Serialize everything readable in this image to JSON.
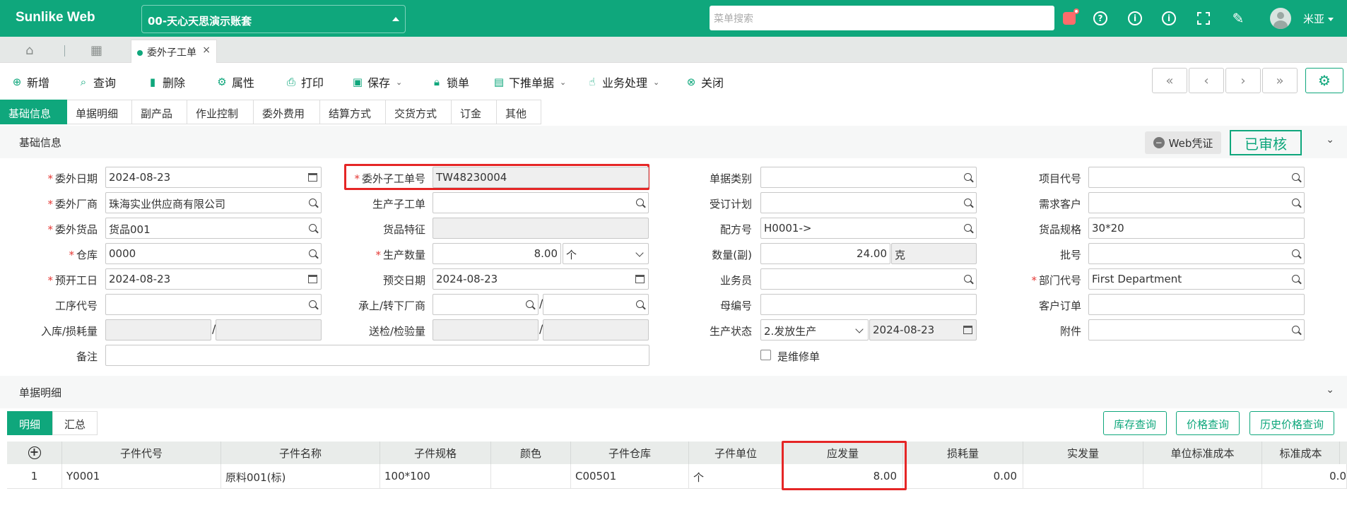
{
  "app": {
    "logo": "Sunlike Web",
    "account": "00-天心天思演示账套",
    "search_placeholder": "菜单搜索",
    "user": "米亚"
  },
  "tabbar": {
    "doc_tab": "委外子工单"
  },
  "toolbar": {
    "add": "新增",
    "query": "查询",
    "delete": "删除",
    "props": "属性",
    "print": "打印",
    "save": "保存",
    "lock": "锁单",
    "push": "下推单据",
    "biz": "业务处理",
    "close": "关闭"
  },
  "nav_buttons": [
    "«",
    "‹",
    "›",
    "»"
  ],
  "subtabs": [
    "基础信息",
    "单据明细",
    "副产品",
    "作业控制",
    "委外费用",
    "结算方式",
    "交货方式",
    "订金",
    "其他"
  ],
  "basic": {
    "title": "基础信息",
    "web_voucher": "Web凭证",
    "stamp": "已审核"
  },
  "form": {
    "col1": [
      {
        "label": "委外日期",
        "req": true,
        "value": "2024-08-23"
      },
      {
        "label": "委外厂商",
        "req": true,
        "value": "珠海实业供应商有限公司"
      },
      {
        "label": "委外货品",
        "req": true,
        "value": "货品001"
      },
      {
        "label": "仓库",
        "req": true,
        "value": "0000"
      },
      {
        "label": "预开工日",
        "req": true,
        "value": "2024-08-23"
      },
      {
        "label": "工序代号",
        "req": false,
        "value": ""
      },
      {
        "label": "入库/损耗量",
        "req": false,
        "value": ""
      },
      {
        "label": "备注",
        "req": false,
        "value": ""
      }
    ],
    "col2": [
      {
        "label": "委外子工单号",
        "req": true,
        "value": "TW48230004"
      },
      {
        "label": "生产子工单",
        "req": false,
        "value": ""
      },
      {
        "label": "货品特征",
        "req": false,
        "value": ""
      },
      {
        "label": "生产数量",
        "req": true,
        "value": "8.00",
        "unit": "个"
      },
      {
        "label": "预交日期",
        "req": false,
        "value": "2024-08-23"
      },
      {
        "label": "承上/转下厂商",
        "req": false,
        "value": ""
      },
      {
        "label": "送检/检验量",
        "req": false,
        "value": ""
      }
    ],
    "col3": [
      {
        "label": "单据类别",
        "value": ""
      },
      {
        "label": "受订计划",
        "value": ""
      },
      {
        "label": "配方号",
        "value": "H0001->"
      },
      {
        "label": "数量(副)",
        "value": "24.00",
        "unit": "克"
      },
      {
        "label": "业务员",
        "value": ""
      },
      {
        "label": "母编号",
        "value": ""
      },
      {
        "label": "生产状态",
        "value": "2.发放生产",
        "date": "2024-08-23"
      },
      {
        "label": "是维修单",
        "value": ""
      }
    ],
    "col4": [
      {
        "label": "项目代号",
        "req": false,
        "value": ""
      },
      {
        "label": "需求客户",
        "req": false,
        "value": ""
      },
      {
        "label": "货品规格",
        "req": false,
        "value": "30*20"
      },
      {
        "label": "批号",
        "req": false,
        "value": ""
      },
      {
        "label": "部门代号",
        "req": true,
        "value": "First Department"
      },
      {
        "label": "客户订单",
        "req": false,
        "value": ""
      },
      {
        "label": "附件",
        "req": false,
        "value": ""
      }
    ]
  },
  "detail": {
    "title": "单据明细",
    "seg": [
      "明细",
      "汇总"
    ],
    "buttons": [
      "库存查询",
      "价格查询",
      "历史价格查询"
    ],
    "columns": [
      "",
      "子件代号",
      "子件名称",
      "子件规格",
      "颜色",
      "子件仓库",
      "子件单位",
      "应发量",
      "损耗量",
      "实发量",
      "单位标准成本",
      "标准成本"
    ],
    "rows": [
      [
        "1",
        "Y0001",
        "原料001(标)",
        "100*100",
        "",
        "C00501",
        "个",
        "8.00",
        "0.00",
        "",
        "",
        "0.0"
      ]
    ]
  }
}
